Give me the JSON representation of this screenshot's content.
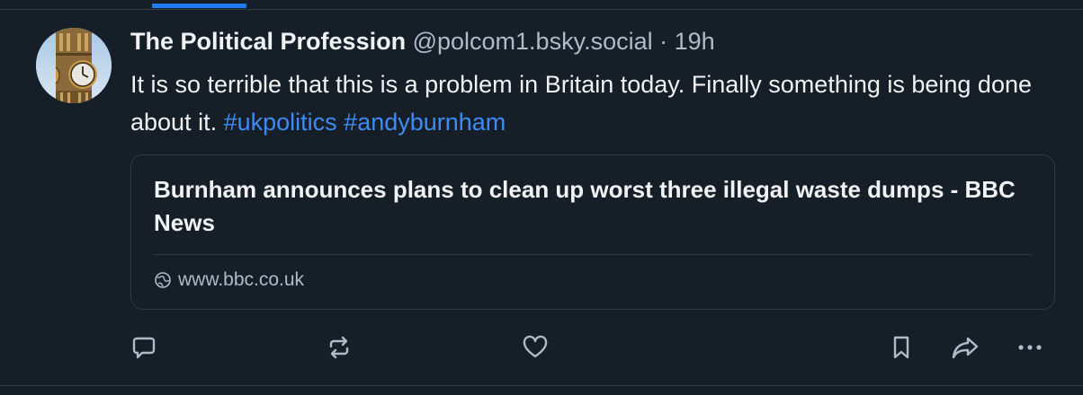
{
  "post": {
    "author_name": "The Political Profession",
    "handle": "@polcom1.bsky.social",
    "separator": "·",
    "time": "19h",
    "text_prefix": "It is so terrible that this is a problem in Britain today. Finally something is being done about it.",
    "hashtags": [
      "#ukpolitics",
      "#andyburnham"
    ],
    "avatar_icon": "big-ben-clock-tower"
  },
  "link_card": {
    "title": "Burnham announces plans to clean up worst three illegal waste dumps - BBC News",
    "domain": "www.bbc.co.uk",
    "domain_icon": "globe-icon"
  },
  "actions": {
    "reply_icon": "comment-bubble",
    "repost_icon": "repost-arrows",
    "like_icon": "heart-outline",
    "bookmark_icon": "bookmark-outline",
    "share_icon": "share-arrow",
    "more_icon": "ellipsis-horizontal"
  },
  "colors": {
    "background": "#161e27",
    "text": "#f1f3f5",
    "muted": "#aebbc9",
    "link": "#3d8bf5",
    "border": "#2e3a48",
    "accent": "#1d7cf2"
  }
}
